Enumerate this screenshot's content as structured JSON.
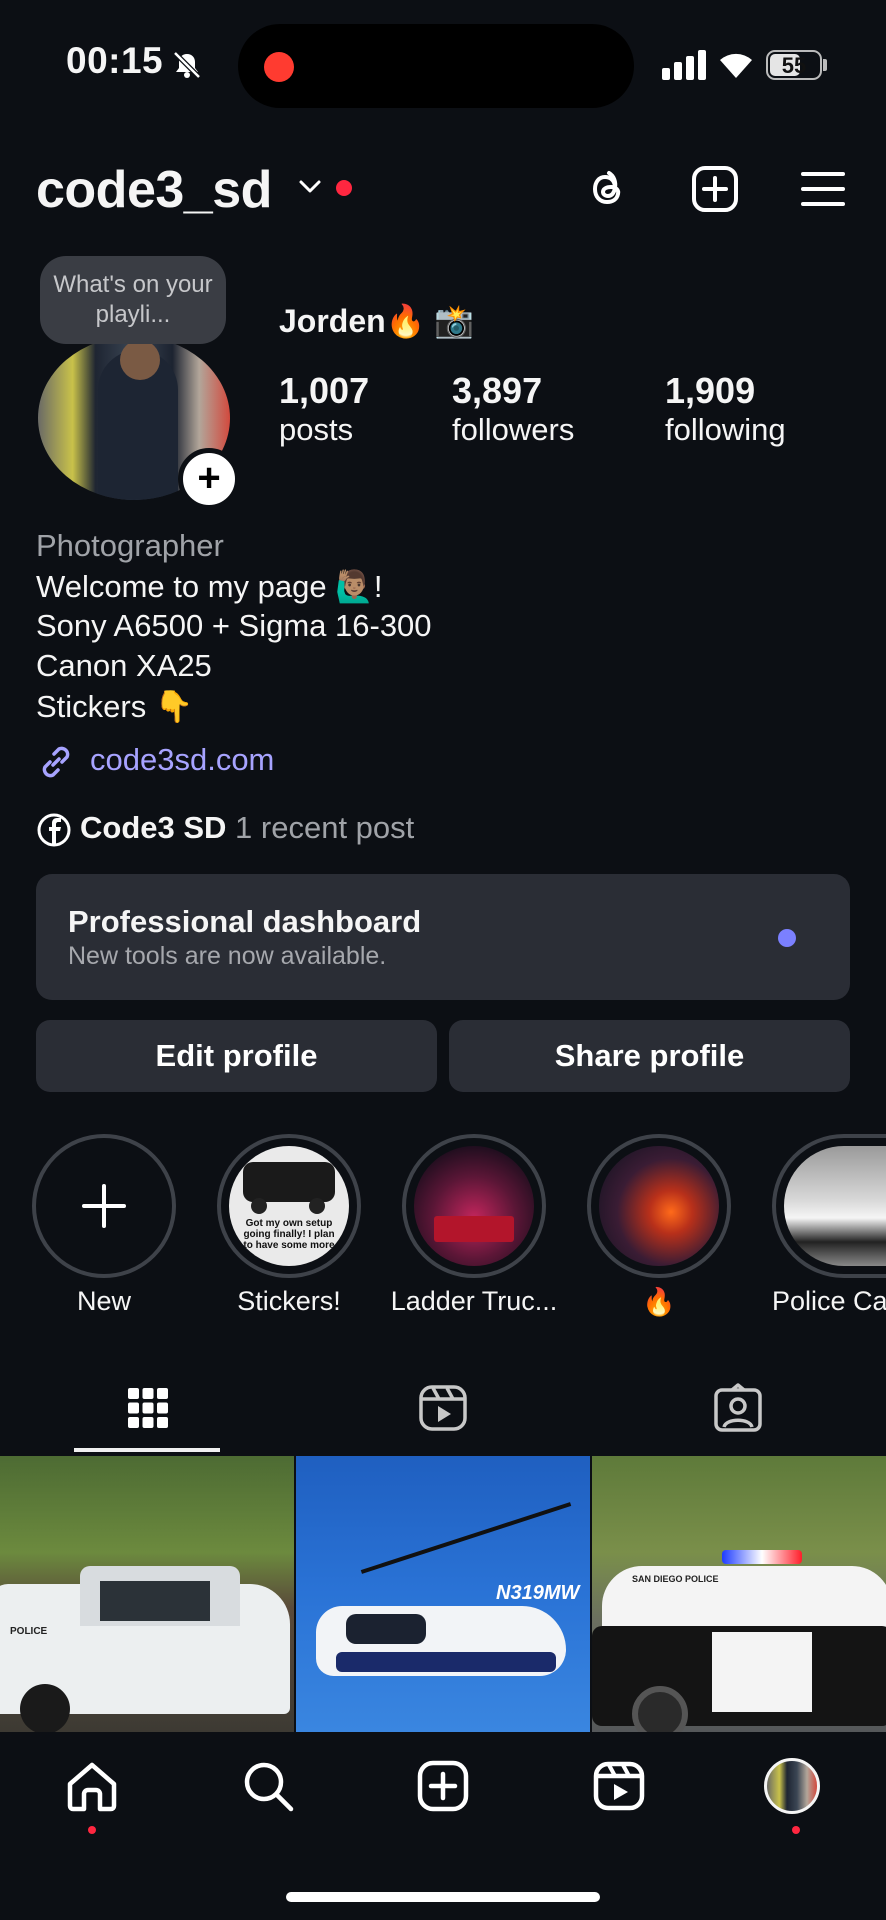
{
  "status_bar": {
    "time": "00:15",
    "battery": "55"
  },
  "header": {
    "username": "code3_sd"
  },
  "profile": {
    "note": "What's on your playli...",
    "display_name": "Jorden🔥 📸",
    "stats": [
      {
        "value": "1,007",
        "label": "posts"
      },
      {
        "value": "3,897",
        "label": "followers"
      },
      {
        "value": "1,909",
        "label": "following"
      }
    ],
    "bio": {
      "category": "Photographer",
      "lines": [
        "Welcome to my page 🙋🏽‍♂️!",
        "Sony A6500 + Sigma 16-300",
        "Canon XA25",
        "Stickers 👇"
      ]
    },
    "link": "code3sd.com",
    "facebook": {
      "name": "Code3 SD",
      "meta": "1 recent post"
    }
  },
  "dashboard": {
    "title": "Professional dashboard",
    "subtitle": "New tools are now available."
  },
  "buttons": {
    "edit": "Edit profile",
    "share": "Share profile"
  },
  "highlights": [
    {
      "label": "New"
    },
    {
      "label": "Stickers!",
      "caption": "Got my own setup going finally! I plan to have some more"
    },
    {
      "label": "Ladder Truc..."
    },
    {
      "label": "🔥"
    },
    {
      "label": "Police Ca"
    }
  ],
  "posts": [
    {
      "text": "POLICE"
    },
    {
      "text": "N319MW"
    },
    {
      "text": "SAN DIEGO POLICE"
    }
  ],
  "icons": {
    "threads": "threads-icon",
    "create": "plus-square-icon",
    "menu": "hamburger-menu-icon",
    "grid": "grid-icon",
    "reels": "reels-icon",
    "tagged": "tagged-icon",
    "home": "home-icon",
    "search": "search-icon",
    "link": "link-icon",
    "facebook": "facebook-icon"
  },
  "colors": {
    "accent_link": "#a7a3ff",
    "notification_dot": "#ff2740",
    "dashboard_dot": "#7b80ff",
    "background": "#0c0f14"
  }
}
